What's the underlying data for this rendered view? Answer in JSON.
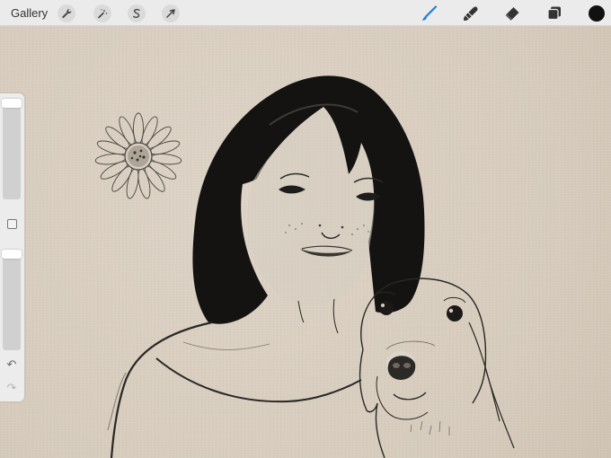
{
  "toolbar": {
    "gallery_label": "Gallery",
    "left_tools": [
      {
        "name": "actions",
        "icon": "wrench-icon"
      },
      {
        "name": "adjustments",
        "icon": "magic-wand-icon"
      },
      {
        "name": "selection",
        "icon": "selection-s-icon"
      },
      {
        "name": "transform",
        "icon": "arrow-cursor-icon"
      }
    ],
    "right_tools": [
      {
        "name": "brush",
        "icon": "brush-icon",
        "active": true
      },
      {
        "name": "smudge",
        "icon": "smudge-finger-icon",
        "active": false
      },
      {
        "name": "eraser",
        "icon": "eraser-icon",
        "active": false
      },
      {
        "name": "layers",
        "icon": "layers-icon",
        "active": false
      }
    ],
    "active_color": "#111111",
    "accent_color": "#1a7fe0"
  },
  "sidebar": {
    "brush_size": 0.9,
    "opacity": 1.0,
    "modify_icon": "square-icon",
    "undo_icon": "undo-arrow-icon",
    "redo_icon": "redo-arrow-icon"
  },
  "canvas": {
    "paper_color": "#d8cdbf",
    "subjects": [
      "woman-portrait",
      "dog",
      "daisy-flower"
    ]
  }
}
